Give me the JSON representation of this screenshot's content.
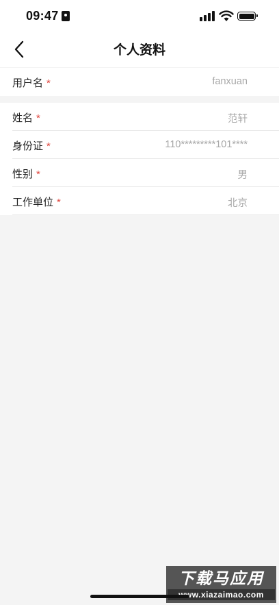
{
  "status_bar": {
    "time": "09:47",
    "icons": [
      "badge-icon",
      "signal-icon",
      "wifi-icon",
      "battery-icon"
    ]
  },
  "nav": {
    "back_icon": "chevron-left-icon",
    "title": "个人资料"
  },
  "account_section": {
    "rows": [
      {
        "label": "用户名",
        "required_mark": "*",
        "value": "fanxuan"
      }
    ]
  },
  "profile_section": {
    "rows": [
      {
        "label": "姓名",
        "required_mark": "*",
        "value": "范轩"
      },
      {
        "label": "身份证",
        "required_mark": "*",
        "value": "110*********101****"
      },
      {
        "label": "性别",
        "required_mark": "*",
        "value": "男"
      },
      {
        "label": "工作单位",
        "required_mark": "*",
        "value": "北京"
      }
    ]
  },
  "colors": {
    "required": "#e0473f",
    "value_text": "#a8a8a8",
    "background": "#f4f4f4"
  },
  "watermark": {
    "title": "下载马应用",
    "url": "www.xiazaimao.com"
  }
}
